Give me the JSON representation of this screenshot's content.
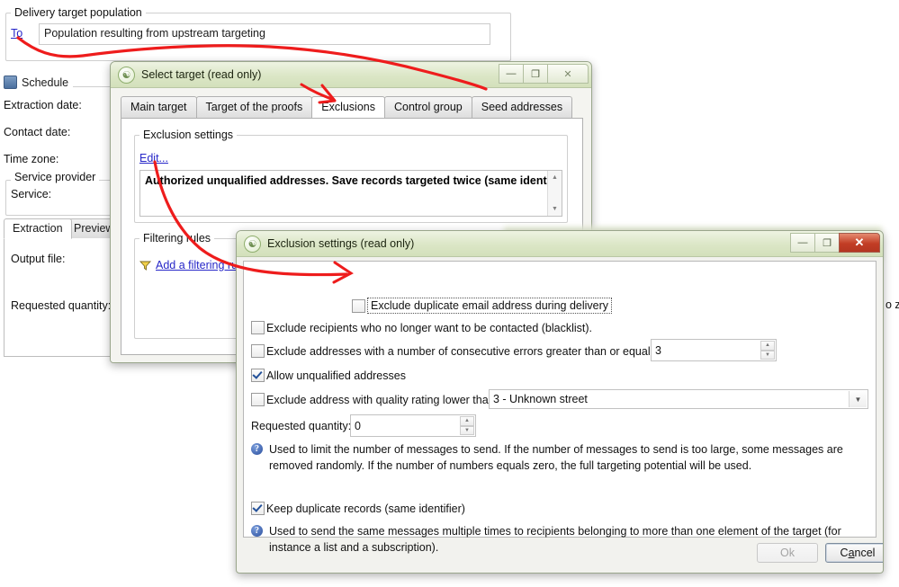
{
  "background_form": {
    "delivery_group_title": "Delivery target population",
    "to_link": "To",
    "population_value": "Population resulting from upstream targeting",
    "schedule_group_title": "Schedule",
    "schedule_icon": "calendar-icon",
    "labels": [
      "Extraction date:",
      "Contact date:",
      "Time zone:"
    ],
    "service_provider_group_title": "Service provider",
    "service_label": "Service:",
    "tabs": [
      {
        "label": "Extraction",
        "active": true
      },
      {
        "label": "Preview",
        "active": false
      }
    ],
    "output_file_label": "Output file:",
    "requested_quantity_label": "Requested quantity:",
    "edge_fragment": "o z"
  },
  "select_target_window": {
    "title": "Select target (read only)",
    "title_icon": "app-logo-icon",
    "buttons": {
      "minimize": "minimize-icon",
      "maximize": "maximize-icon",
      "close": "close-icon",
      "minimize_glyph": "—",
      "maximize_glyph": "❐",
      "close_glyph": "✕"
    },
    "tabs": [
      {
        "label": "Main target",
        "active": false
      },
      {
        "label": "Target of the proofs",
        "active": false
      },
      {
        "label": "Exclusions",
        "active": true
      },
      {
        "label": "Control group",
        "active": false
      },
      {
        "label": "Seed addresses",
        "active": false
      }
    ],
    "exclusion_settings_group": "Exclusion settings",
    "edit_link": "Edit...",
    "summary_text": "Authorized unqualified addresses. Save records targeted twice (same identifier).",
    "filtering_rules_group": "Filtering rules",
    "add_filtering_rule_link": "Add a filtering rule",
    "add_filtering_rule_icon": "filter-icon"
  },
  "exclusion_dialog": {
    "title": "Exclusion settings (read only)",
    "title_icon": "app-logo-icon",
    "buttons": {
      "minimize_glyph": "—",
      "maximize_glyph": "❐",
      "close_glyph": "✕"
    },
    "checkboxes": [
      {
        "id": "exclude-duplicate-email",
        "label": "Exclude duplicate email address during delivery",
        "checked": false,
        "focused": true
      },
      {
        "id": "exclude-blacklist",
        "label": "Exclude recipients who no longer want to be contacted (blacklist).",
        "checked": false,
        "focused": false
      },
      {
        "id": "exclude-consecutive-errors",
        "label": "Exclude addresses with a number of consecutive errors greater than or equal to",
        "checked": false,
        "focused": false
      },
      {
        "id": "allow-unqualified-addresses",
        "label": "Allow unqualified addresses",
        "checked": true,
        "focused": false
      },
      {
        "id": "exclude-quality-rating",
        "label": "Exclude address with quality rating lower than",
        "checked": false,
        "focused": false
      }
    ],
    "consecutive_errors_value": "3",
    "quality_rating_value": "3 - Unknown street",
    "requested_quantity_label": "Requested quantity:",
    "requested_quantity_value": "0",
    "help_1": "Used to limit the number of messages to send. If the number of messages to send is too large, some messages are removed randomly. If the number of numbers equals zero, the full targeting potential will be used.",
    "keep_duplicates": {
      "id": "keep-duplicate-records",
      "label": "Keep duplicate records (same identifier)",
      "checked": true
    },
    "help_2": "Used to send the same messages multiple times to recipients belonging to more than one element of the target (for instance a list and a subscription).",
    "help_icon": "help-circle-icon",
    "ok_button": {
      "label": "Ok",
      "disabled": true
    },
    "cancel_button": {
      "label": "Cancel",
      "disabled": false,
      "accel_index": 1
    }
  },
  "annotations": {
    "color": "#ee1c1c",
    "arrow_1_target": "Exclusions tab",
    "arrow_2_target": "Exclude duplicate email address during delivery checkbox"
  },
  "colors": {
    "title_bar_green": "#dbe6c6",
    "close_red": "#c23d25",
    "link_blue": "#2626c8",
    "annotation_red": "#ee1c1c",
    "help_blue": "#2b4f9e"
  }
}
